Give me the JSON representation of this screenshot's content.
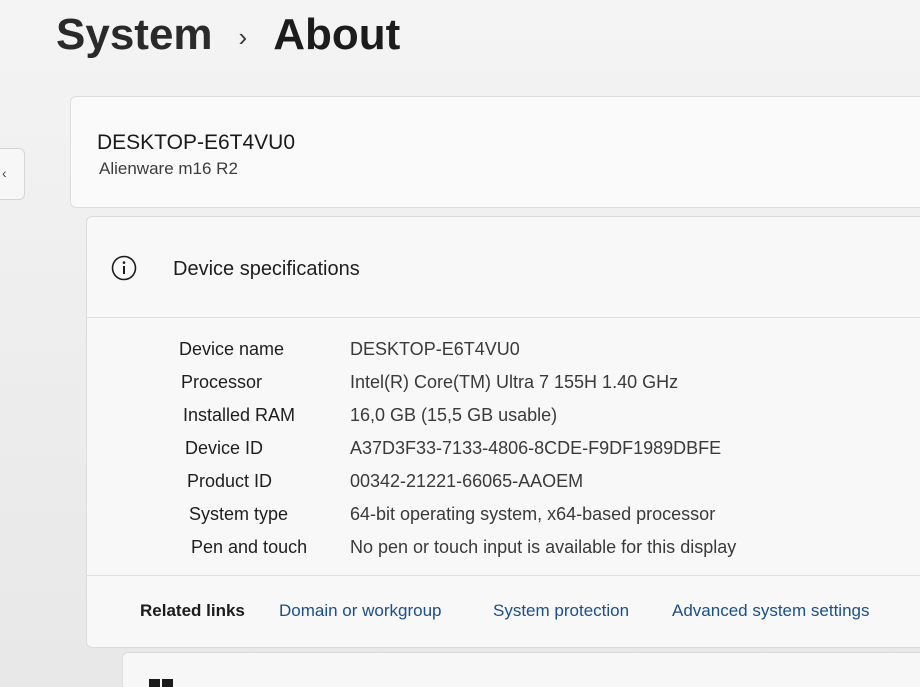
{
  "breadcrumb": {
    "parent": "System",
    "separator": "›",
    "current": "About"
  },
  "device": {
    "name": "DESKTOP-E6T4VU0",
    "model": "Alienware m16 R2"
  },
  "specs": {
    "title": "Device specifications",
    "icon": "info-icon",
    "rows": [
      {
        "label": "Device name",
        "value": "DESKTOP-E6T4VU0"
      },
      {
        "label": "Processor",
        "value": "Intel(R) Core(TM) Ultra 7 155H   1.40 GHz"
      },
      {
        "label": "Installed RAM",
        "value": "16,0 GB (15,5 GB usable)"
      },
      {
        "label": "Device ID",
        "value": "A37D3F33-7133-4806-8CDE-F9DF1989DBFE"
      },
      {
        "label": "Product ID",
        "value": "00342-21221-66065-AAOEM"
      },
      {
        "label": "System type",
        "value": "64-bit operating system, x64-based processor"
      },
      {
        "label": "Pen and touch",
        "value": "No pen or touch input is available for this display"
      }
    ]
  },
  "related": {
    "label": "Related links",
    "links": [
      "Domain or workgroup",
      "System protection",
      "Advanced system settings"
    ]
  },
  "colors": {
    "link": "#1a4e8c",
    "background": "#f1f1f1",
    "card": "#f8f8f8"
  }
}
